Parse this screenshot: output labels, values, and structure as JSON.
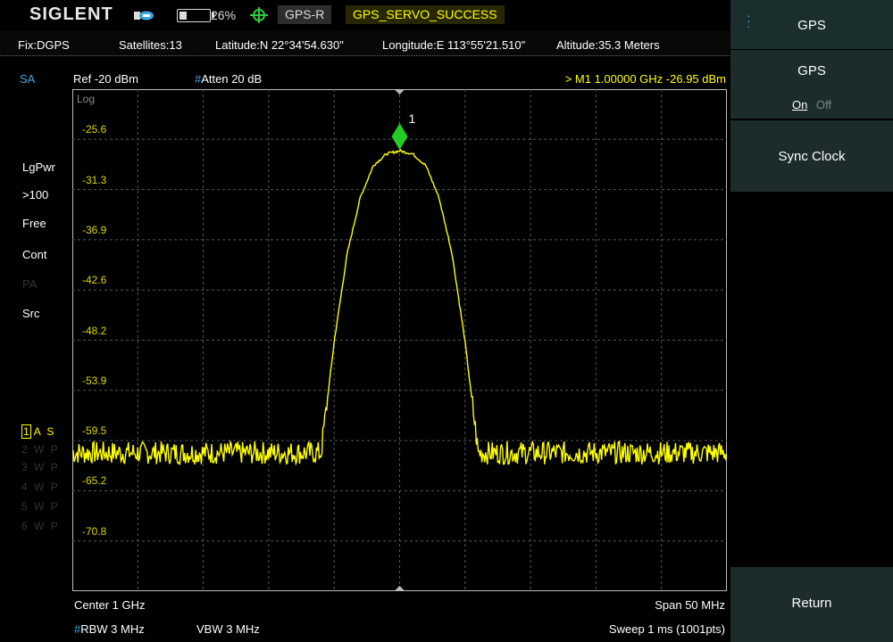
{
  "status": {
    "brand": "SIGLENT",
    "battery_pct": "26%",
    "battery_level": 0.26,
    "gps_ref": "GPS-R",
    "gps_servo": "GPS_SERVO_SUCCESS",
    "icons": [
      "usb-icon",
      "battery-icon",
      "gps-antenna-icon"
    ]
  },
  "gps_info": {
    "fix": "Fix:DGPS",
    "satellites": "Satellites:13",
    "latitude": "Latitude:N 22°34'54.630\"",
    "longitude": "Longitude:E 113°55'21.510\"",
    "altitude": "Altitude:35.3 Meters"
  },
  "header": {
    "mode": "SA",
    "ref_level": "Ref  -20 dBm",
    "atten_hash": "#",
    "atten": "Atten  20 dB",
    "marker_readout": ">  M1    1.00000 GHz   -26.95 dBm"
  },
  "side_labels": {
    "detector": "LgPwr",
    "avg": ">100",
    "trigger": "Free",
    "sweep_mode": "Cont",
    "preamp": "PA",
    "source": "Src"
  },
  "traces": [
    {
      "num": "1",
      "flags": "A S"
    },
    {
      "num": "2",
      "flags": "W P"
    },
    {
      "num": "3",
      "flags": "W P"
    },
    {
      "num": "4",
      "flags": "W P"
    },
    {
      "num": "5",
      "flags": "W P"
    },
    {
      "num": "6",
      "flags": "W P"
    }
  ],
  "graph": {
    "scale_type": "Log",
    "y_ticks": [
      "-25.6",
      "-31.3",
      "-36.9",
      "-42.6",
      "-48.2",
      "-53.9",
      "-59.5",
      "-65.2",
      "-70.8"
    ],
    "marker_label": "1",
    "colors": {
      "trace": "#ffff00",
      "marker": "#22cc22",
      "grid": "#555555",
      "border": "#bbbbbb"
    }
  },
  "chart_data": {
    "type": "line",
    "xlabel": "",
    "ylabel": "",
    "ylim": [
      -76.6,
      -20
    ],
    "xlim": [
      -25,
      25
    ],
    "grid": true,
    "series": [
      {
        "x": [
          -25,
          -20,
          -15,
          -10,
          -6,
          -5,
          -4,
          -3,
          -2,
          -1,
          0,
          1,
          2,
          3,
          4,
          5,
          6,
          10,
          15,
          20,
          25
        ],
        "y": [
          -61.0,
          -61.0,
          -61.0,
          -61.0,
          -61.0,
          -48.5,
          -38.5,
          -32.2,
          -28.6,
          -27.3,
          -26.95,
          -27.3,
          -28.6,
          -32.2,
          -38.5,
          -48.5,
          -61.0,
          -61.0,
          -61.0,
          -61.0,
          -61.0
        ]
      }
    ],
    "marker": {
      "x": 0,
      "y": -26.95,
      "label": "1"
    }
  },
  "footer": {
    "center": "Center  1 GHz",
    "span": "Span  50 MHz",
    "rbw_hash": "#",
    "rbw": "RBW  3 MHz",
    "vbw": "VBW  3 MHz",
    "sweep": "Sweep  1 ms (1001pts)"
  },
  "softkeys": {
    "title": "GPS",
    "gps_label": "GPS",
    "gps_on": "On",
    "gps_off": "Off",
    "sync_clock": "Sync Clock",
    "return": "Return"
  }
}
